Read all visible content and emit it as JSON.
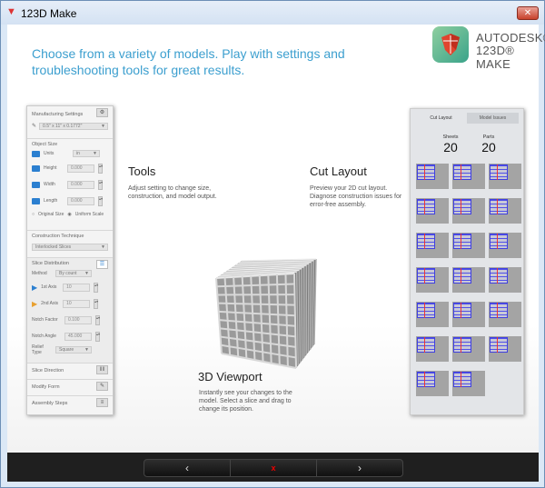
{
  "window": {
    "title": "123D Make",
    "close": "✕"
  },
  "header": {
    "headline": "Choose from a variety of models. Play with settings and troubleshooting tools for great results.",
    "brand_line1": "AUTODESK®",
    "brand_line2": "123D® MAKE"
  },
  "left_panel": {
    "manufacturing_settings": "Manufacturing Settings",
    "sheet_size": "0.5\" x 11\" x 0.1772\"",
    "object_size": "Object Size",
    "units_label": "Units",
    "units_value": "in",
    "height_label": "Height",
    "height_value": "0.000",
    "width_label": "Width",
    "width_value": "0.000",
    "length_label": "Length",
    "length_value": "0.000",
    "original_size": "Original Size",
    "uniform_scale": "Uniform Scale",
    "construction_technique": "Construction Technique",
    "technique_value": "Interlocked Slices",
    "slice_distribution": "Slice Distribution",
    "method_label": "Method",
    "method_value": "By count",
    "axis1_label": "1st Axis",
    "axis1_value": "10",
    "axis2_label": "2nd Axis",
    "axis2_value": "10",
    "notch_factor_label": "Notch Factor",
    "notch_factor_value": "0.100",
    "notch_angle_label": "Notch Angle",
    "notch_angle_value": "45.000",
    "relief_type_label": "Relief Type",
    "relief_type_value": "Square",
    "slice_direction": "Slice Direction",
    "modify_form": "Modify Form",
    "assembly_steps": "Assembly Steps"
  },
  "features": {
    "tools_title": "Tools",
    "tools_text": "Adjust setting to change size, construction, and model output.",
    "cut_title": "Cut Layout",
    "cut_text": "Preview your 2D cut layout. Diagnose construction issues for error-free assembly.",
    "viewport_title": "3D Viewport",
    "viewport_text": "Instantly see your changes to the model. Select a slice and drag to change its position."
  },
  "cut_panel": {
    "tab_cut": "Cut Layout",
    "tab_issues": "Model Issues",
    "sheets_label": "Sheets",
    "sheets_value": "20",
    "parts_label": "Parts",
    "parts_value": "20"
  },
  "nav": {
    "prev": "‹",
    "close": "x",
    "next": "›"
  },
  "colors": {
    "accent": "#3c9fcf",
    "axis1": "#2b7fd0",
    "axis2": "#e8a030"
  }
}
